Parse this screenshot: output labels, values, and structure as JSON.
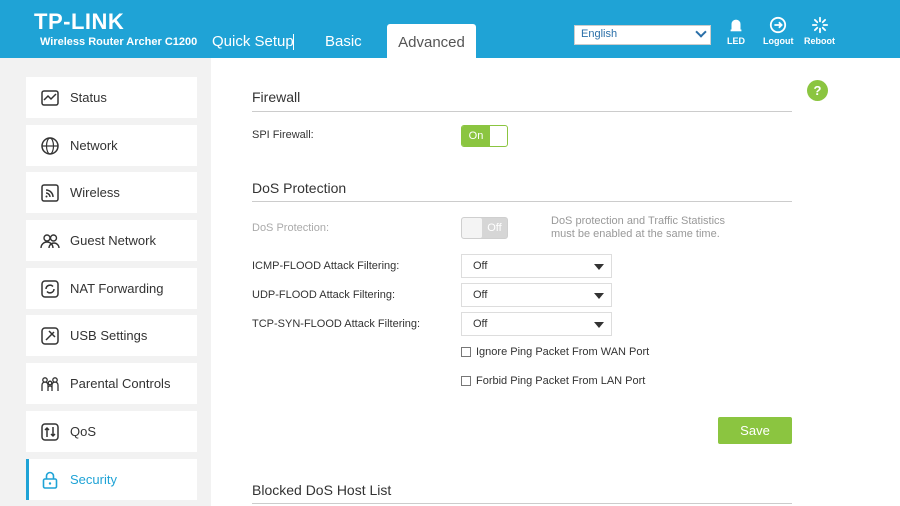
{
  "header": {
    "logo": "TP-LINK",
    "model": "Wireless Router Archer C1200",
    "tabs": [
      {
        "label": "Quick Setup"
      },
      {
        "label": "Basic"
      },
      {
        "label": "Advanced"
      }
    ],
    "language": "English",
    "buttons": {
      "led": "LED",
      "logout": "Logout",
      "reboot": "Reboot"
    },
    "colors": {
      "brand": "#1fa3d6",
      "accent": "#8bc540"
    }
  },
  "sidebar": {
    "items": [
      {
        "label": "Status",
        "icon": "status-icon"
      },
      {
        "label": "Network",
        "icon": "globe-icon"
      },
      {
        "label": "Wireless",
        "icon": "wireless-icon"
      },
      {
        "label": "Guest Network",
        "icon": "guest-users-icon"
      },
      {
        "label": "NAT Forwarding",
        "icon": "nat-forwarding-icon"
      },
      {
        "label": "USB Settings",
        "icon": "usb-icon"
      },
      {
        "label": "Parental Controls",
        "icon": "family-icon"
      },
      {
        "label": "QoS",
        "icon": "qos-icon"
      },
      {
        "label": "Security",
        "icon": "lock-icon"
      }
    ],
    "active": "Security"
  },
  "help": "?",
  "firewall": {
    "title": "Firewall",
    "spi_label": "SPI Firewall:",
    "spi_state": "On"
  },
  "dos": {
    "title": "DoS Protection",
    "protection_label": "DoS Protection:",
    "protection_state": "Off",
    "note_line1": "DoS protection and Traffic Statistics",
    "note_line2": "must be enabled at the same time.",
    "icmp_label": "ICMP-FLOOD Attack Filtering:",
    "icmp_value": "Off",
    "udp_label": "UDP-FLOOD Attack Filtering:",
    "udp_value": "Off",
    "tcp_label": "TCP-SYN-FLOOD Attack Filtering:",
    "tcp_value": "Off",
    "ignore_ping_label": "Ignore Ping Packet From WAN Port",
    "forbid_ping_label": "Forbid Ping Packet From LAN Port",
    "save_label": "Save"
  },
  "blocked": {
    "title": "Blocked DoS Host List"
  }
}
